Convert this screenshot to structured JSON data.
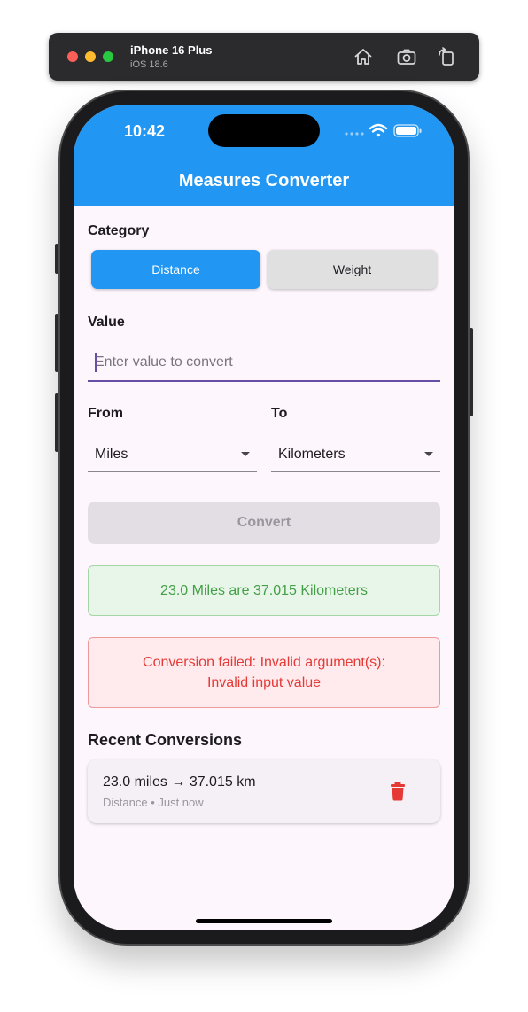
{
  "simulator": {
    "device_name": "iPhone 16 Plus",
    "os_version": "iOS 18.6"
  },
  "status_bar": {
    "time": "10:42"
  },
  "app_bar": {
    "title": "Measures Converter"
  },
  "category": {
    "label": "Category",
    "options": [
      {
        "label": "Distance",
        "selected": true
      },
      {
        "label": "Weight",
        "selected": false
      }
    ]
  },
  "value": {
    "label": "Value",
    "placeholder": "Enter value to convert",
    "current": ""
  },
  "from": {
    "label": "From",
    "selected": "Miles"
  },
  "to": {
    "label": "To",
    "selected": "Kilometers"
  },
  "convert_button": {
    "label": "Convert",
    "enabled": false
  },
  "result": {
    "text": "23.0 Miles are 37.015 Kilometers"
  },
  "error": {
    "line1": "Conversion failed: Invalid argument(s):",
    "line2": "Invalid input value"
  },
  "recent": {
    "title": "Recent Conversions",
    "items": [
      {
        "main": "23.0 miles → 37.015 km",
        "meta": "Distance • Just now"
      }
    ]
  },
  "colors": {
    "primary": "#2196f3",
    "focus_underline": "#6750a4",
    "success_text": "#43a047",
    "error_text": "#e53935",
    "delete_icon": "#e53935",
    "background": "#fdf7fd"
  }
}
